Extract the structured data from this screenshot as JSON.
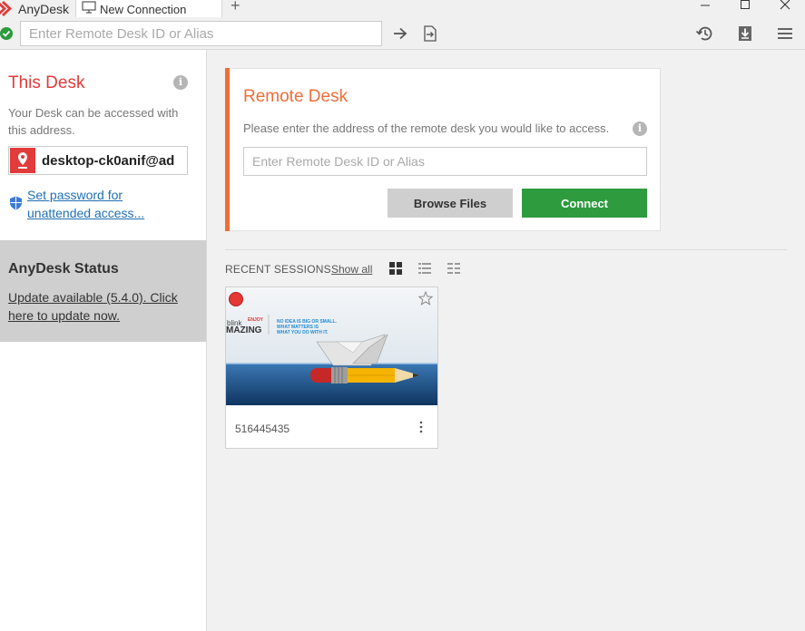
{
  "titlebar": {
    "app_name": "AnyDesk",
    "tab_label": "New Connection",
    "add_tab": "+"
  },
  "toolbar": {
    "address_placeholder": "Enter Remote Desk ID or Alias"
  },
  "sidebar": {
    "this_desk_title": "This Desk",
    "description": "Your Desk can be accessed with this address.",
    "desk_address": "desktop-ck0anif@ad",
    "set_password_link": "Set password for unattended access...",
    "status_title": "AnyDesk Status",
    "update_link": "Update available (5.4.0). Click here to update now."
  },
  "remote": {
    "title": "Remote Desk",
    "description": "Please enter the address of the remote desk you would like to access.",
    "input_placeholder": "Enter Remote Desk ID or Alias",
    "browse_label": "Browse Files",
    "connect_label": "Connect"
  },
  "recent": {
    "label": "RECENT SESSIONS",
    "show_all": "Show all",
    "sessions": [
      {
        "id": "516445435",
        "thumb_brand": "blink",
        "thumb_brand_suffix": "ENJOY",
        "thumb_title": "MAZING",
        "thumb_tagline_1": "NO IDEA IS BIG OR SMALL.",
        "thumb_tagline_2": "WHAT MATTERS IS",
        "thumb_tagline_3": "WHAT YOU DO WITH IT."
      }
    ]
  },
  "colors": {
    "brand_red": "#e23b3b",
    "accent_orange": "#ef6d37",
    "connect_green": "#2e9b3e",
    "link_blue": "#1f6fb2"
  }
}
